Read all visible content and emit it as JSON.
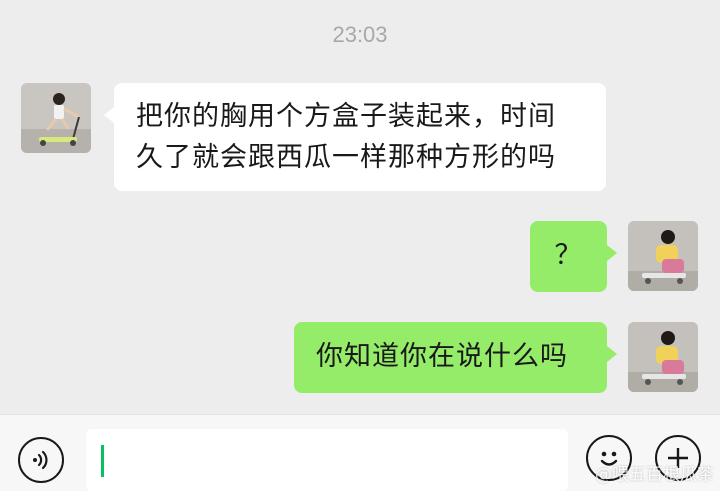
{
  "chat": {
    "timestamp": "23:03",
    "messages": [
      {
        "side": "left",
        "lines": [
          "把你的胸用个方盒子装起来，时间",
          "久了就会跟西瓜一样那种方形的吗"
        ]
      },
      {
        "side": "right",
        "lines": [
          "？"
        ]
      },
      {
        "side": "right",
        "lines": [
          "你知道你在说什么吗"
        ]
      }
    ]
  },
  "input_bar": {
    "voice_icon": "voice-icon",
    "emoji_icon": "emoji-icon",
    "add_icon": "plus-icon",
    "input_value": ""
  },
  "watermark": {
    "text": "@喂五百根瓜茶"
  },
  "colors": {
    "background": "#ededed",
    "received_bubble": "#ffffff",
    "sent_bubble": "#95ec69",
    "caret": "#07c160"
  }
}
